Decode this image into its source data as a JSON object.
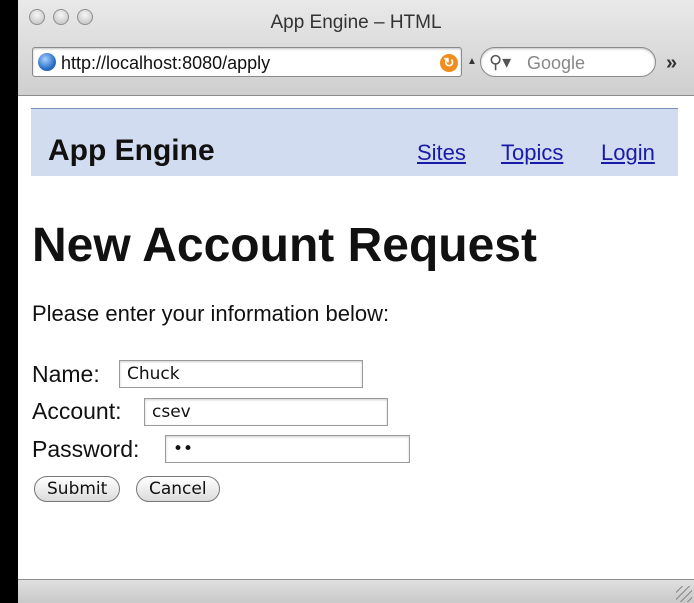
{
  "window": {
    "title": "App Engine – HTML"
  },
  "toolbar": {
    "url": "http://localhost:8080/apply",
    "search_placeholder": "Google",
    "overflow_label": "»"
  },
  "site": {
    "brand": "App Engine",
    "nav": [
      {
        "label": "Sites"
      },
      {
        "label": "Topics"
      },
      {
        "label": "Login"
      }
    ]
  },
  "page": {
    "title": "New Account Request",
    "intro": "Please enter your information below:"
  },
  "form": {
    "name_label": "Name:",
    "name_value": "Chuck",
    "account_label": "Account:",
    "account_value": "csev",
    "password_label": "Password:",
    "password_value": "••",
    "submit_label": "Submit",
    "cancel_label": "Cancel"
  },
  "colors": {
    "header_bg": "#d2dcf0",
    "link": "#1a1aa8",
    "reload": "#f08d1c"
  }
}
